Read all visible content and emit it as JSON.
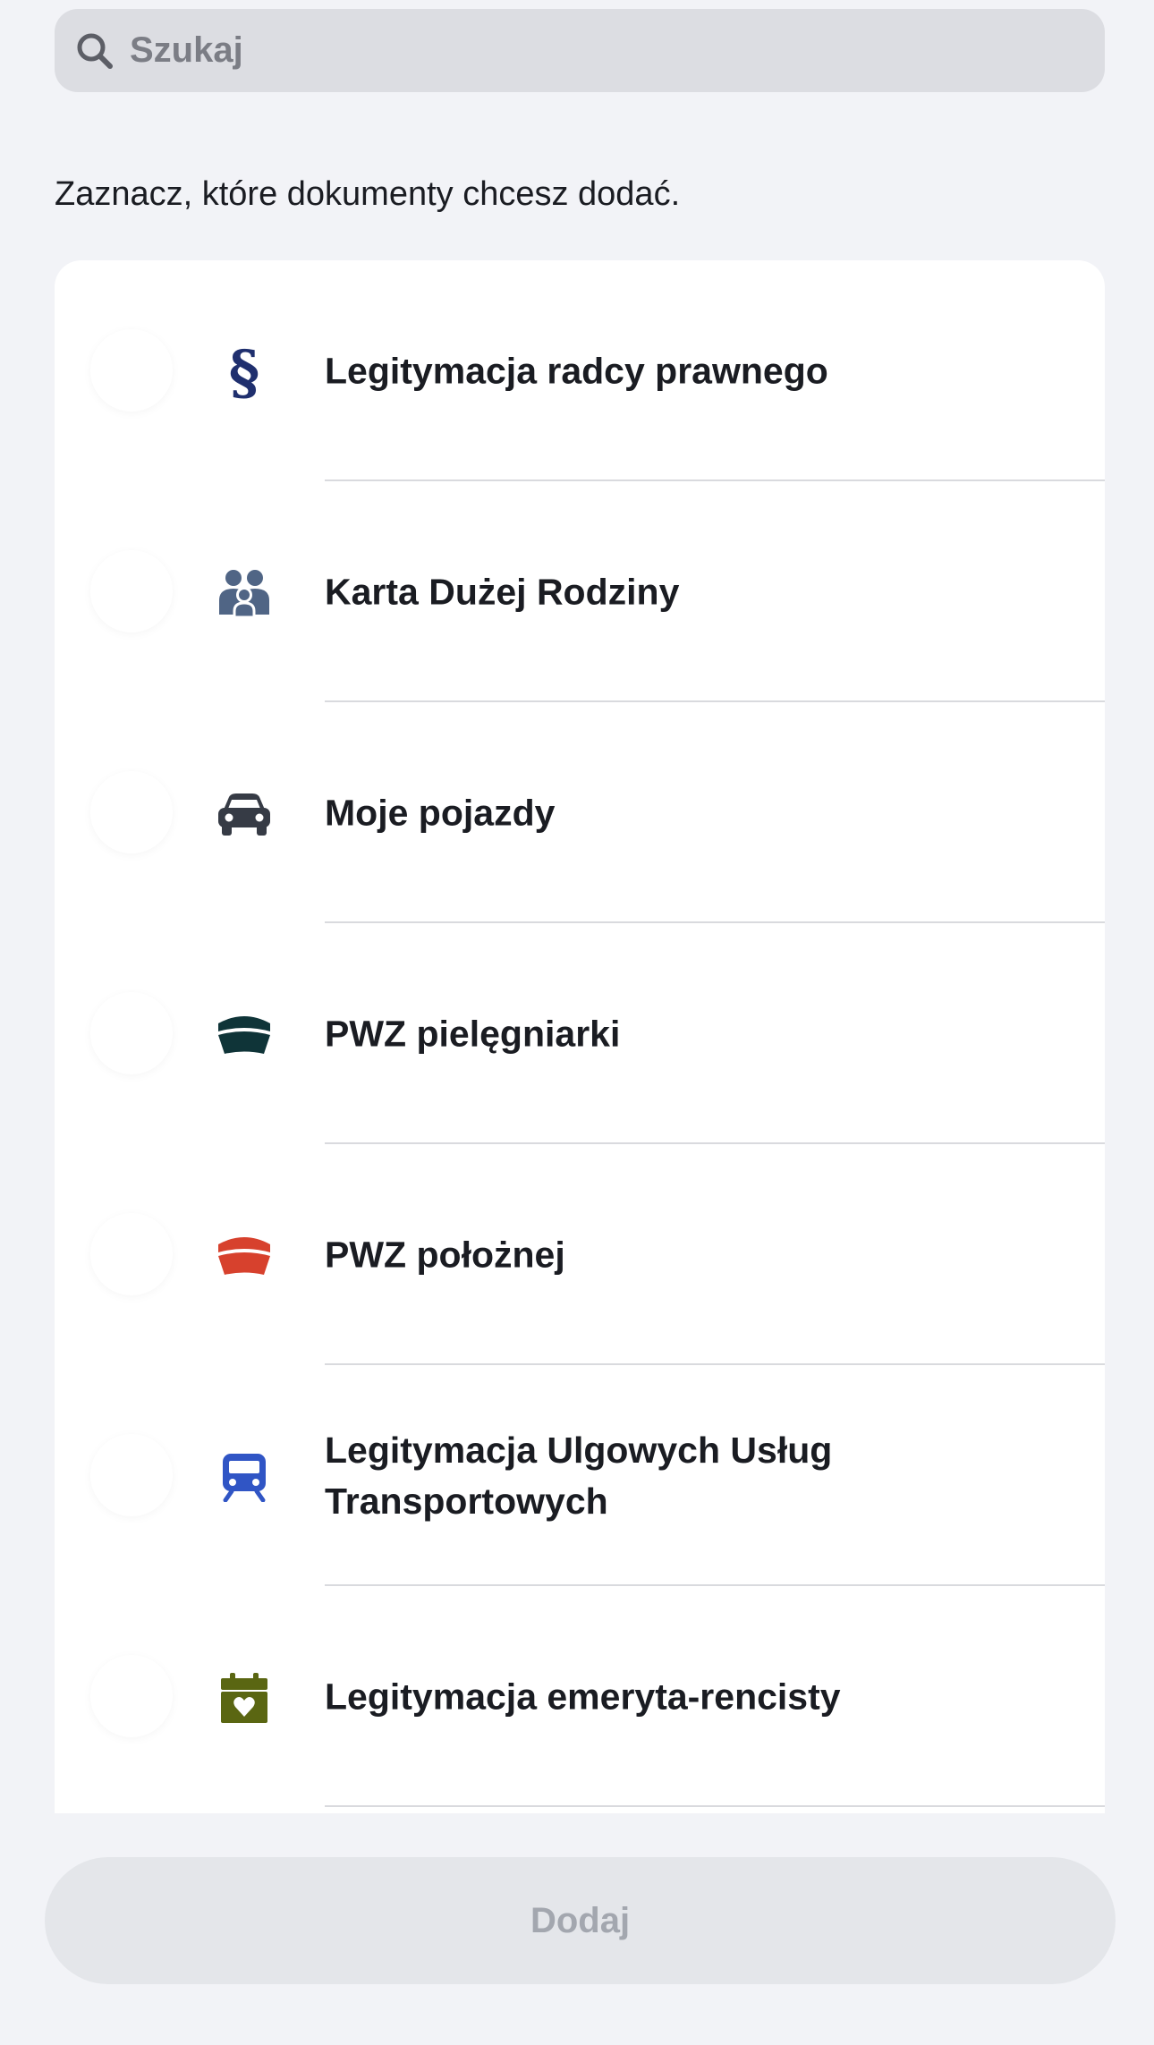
{
  "search": {
    "placeholder": "Szukaj"
  },
  "instructions": "Zaznacz, które dokumenty chcesz dodać.",
  "documents": [
    {
      "label": "Legitymacja radcy prawnego",
      "icon": "paragraph-icon",
      "icon_color": "#1f2f6e"
    },
    {
      "label": "Karta Dużej Rodziny",
      "icon": "family-icon",
      "icon_color": "#506585"
    },
    {
      "label": "Moje pojazdy",
      "icon": "car-icon",
      "icon_color": "#363b45"
    },
    {
      "label": "PWZ pielęgniarki",
      "icon": "nurse-cap-icon",
      "icon_color": "#0f3438"
    },
    {
      "label": "PWZ położnej",
      "icon": "midwife-cap-icon",
      "icon_color": "#d7412d"
    },
    {
      "label": "Legitymacja Ulgowych Usług Transportowych",
      "icon": "train-icon",
      "icon_color": "#3055c5"
    },
    {
      "label": "Legitymacja emeryta-rencisty",
      "icon": "calendar-heart-icon",
      "icon_color": "#5a6612"
    }
  ],
  "add_button": {
    "label": "Dodaj",
    "state": "disabled"
  },
  "colors": {
    "background": "#f2f3f7",
    "card": "#ffffff",
    "search_field": "#dcdde2",
    "button_disabled_bg": "#e4e6ea",
    "button_disabled_text": "#a3a7af"
  }
}
